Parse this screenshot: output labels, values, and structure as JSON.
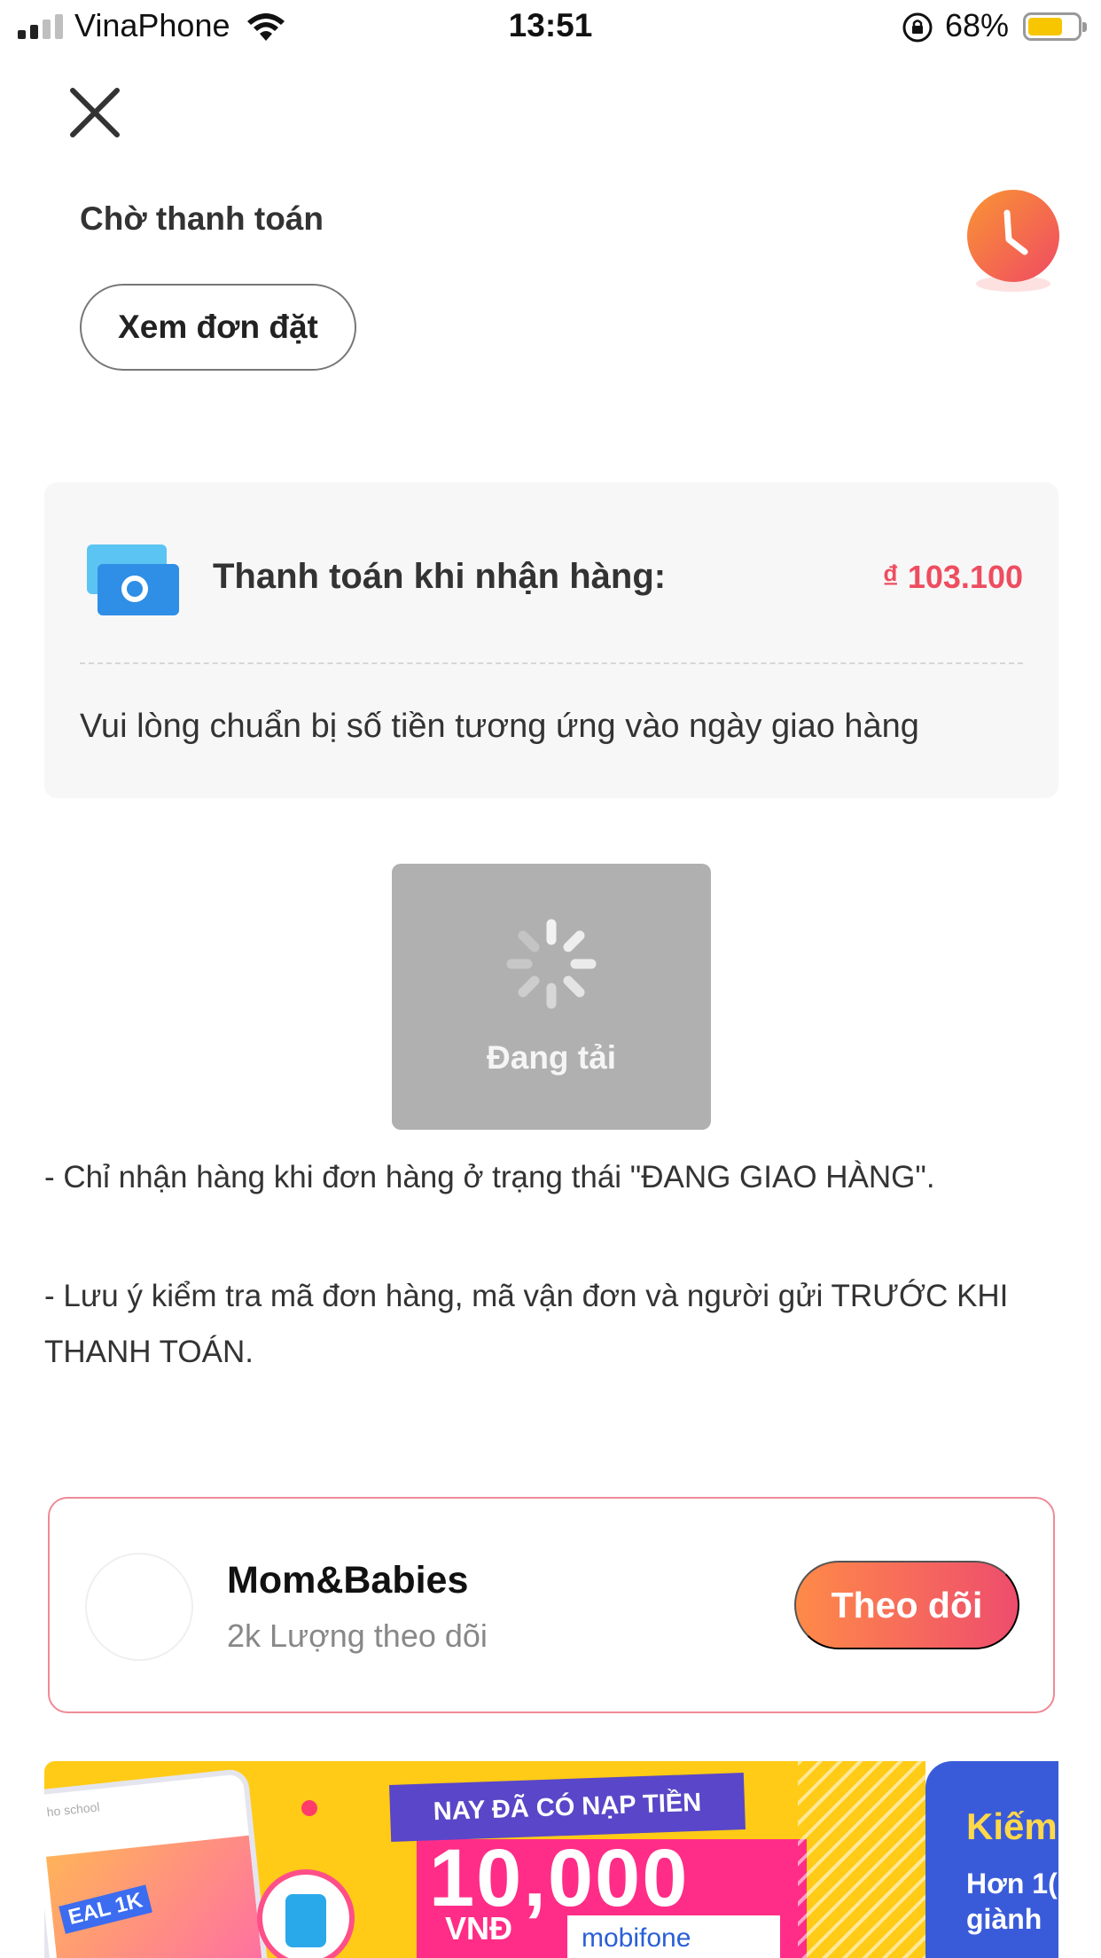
{
  "status_bar": {
    "carrier": "VinaPhone",
    "time": "13:51",
    "battery_percent": "68%",
    "battery_level": 0.68,
    "signal_bars_active": 2,
    "signal_bars_total": 4
  },
  "header": {
    "close_icon": "close-icon",
    "status_title": "Chờ thanh toán",
    "view_order_label": "Xem đơn đặt",
    "badge_icon": "clock-icon"
  },
  "payment": {
    "icon": "cash-icon",
    "label": "Thanh toán khi nhận hàng:",
    "amount": "₫ 103.100",
    "note": "Vui lòng chuẩn bị số tiền tương ứng vào ngày giao hàng"
  },
  "loading": {
    "icon": "spinner-icon",
    "text": "Đang tải"
  },
  "notes": {
    "line1": "- Chỉ nhận hàng khi đơn hàng ở trạng thái \"ĐANG GIAO HÀNG\".",
    "line2": "- Lưu ý kiểm tra mã đơn hàng, mã vận đơn và người gửi TRƯỚC KHI THANH TOÁN."
  },
  "shop": {
    "name": "Mom&Babies",
    "followers": "2k Lượng theo dõi",
    "follow_label": "Theo dõi"
  },
  "banner": {
    "ribbon": "NAY ĐÃ CÓ NẠP TIỀN",
    "amount": "10,000",
    "currency": "VNĐ",
    "brand": "mobifone",
    "phone_tag": "ho school",
    "deal": "EAL 1K"
  },
  "banner2": {
    "title": "Kiếm",
    "line1": "Hơn 1(",
    "line2": "giành"
  },
  "colors": {
    "accent": "#ee4d5f",
    "follow_gradient_start": "#ff8a48",
    "follow_gradient_end": "#ee4d6d",
    "badge": "#f46a3a"
  }
}
